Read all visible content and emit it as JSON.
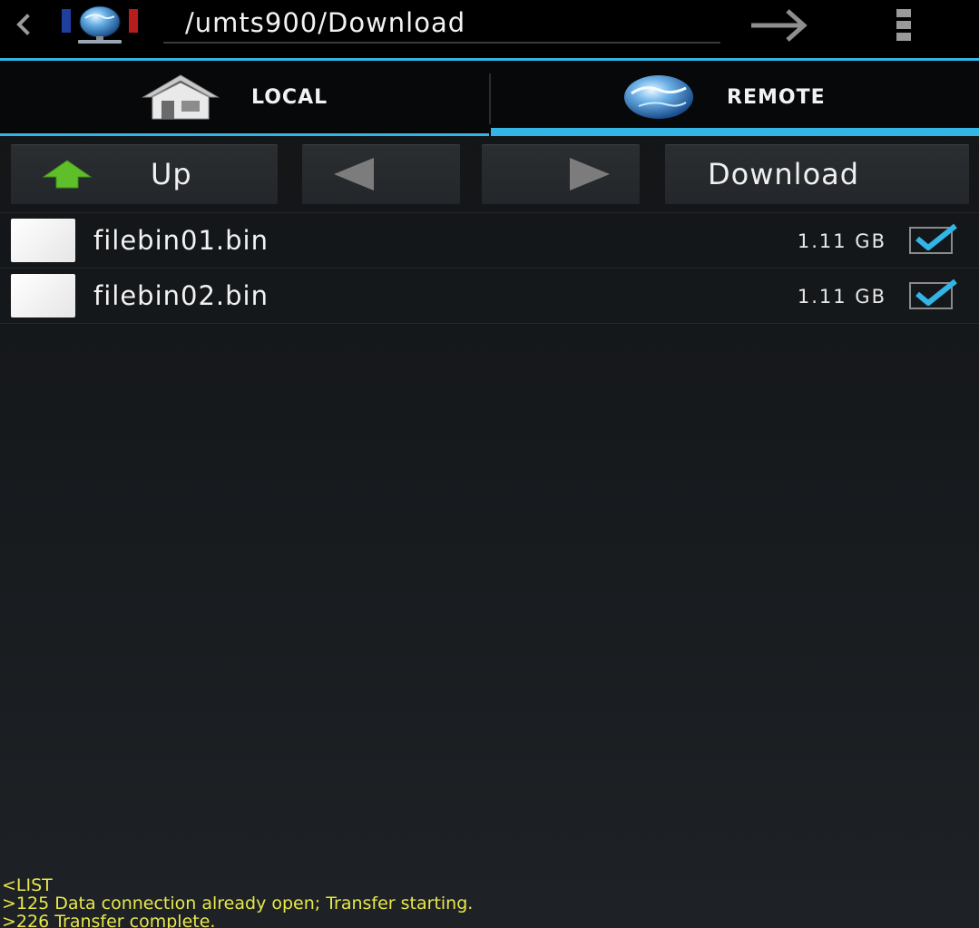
{
  "topbar": {
    "back_icon": "chevron-left-icon",
    "logo_icon": "network-globe-icon",
    "path": "/umts900/Download",
    "go_icon": "arrow-right-icon",
    "menu_icon": "overflow-menu-icon"
  },
  "tabs": [
    {
      "label": "LOCAL",
      "icon": "house-icon",
      "active": false
    },
    {
      "label": "REMOTE",
      "icon": "globe-icon",
      "active": true
    }
  ],
  "toolbar": {
    "up_label": "Up",
    "up_icon": "green-up-arrow-icon",
    "prev_icon": "triangle-left-icon",
    "next_icon": "triangle-right-icon",
    "download_label": "Download"
  },
  "files": [
    {
      "name": "filebin01.bin",
      "size": "1.11 GB",
      "checked": true
    },
    {
      "name": "filebin02.bin",
      "size": "1.11 GB",
      "checked": true
    }
  ],
  "log": [
    "<LIST",
    ">125 Data connection already open; Transfer starting.",
    ">226 Transfer complete."
  ],
  "colors": {
    "accent": "#33b5e5",
    "log_text": "#e8e84a",
    "up_arrow": "#5fbf2a"
  }
}
